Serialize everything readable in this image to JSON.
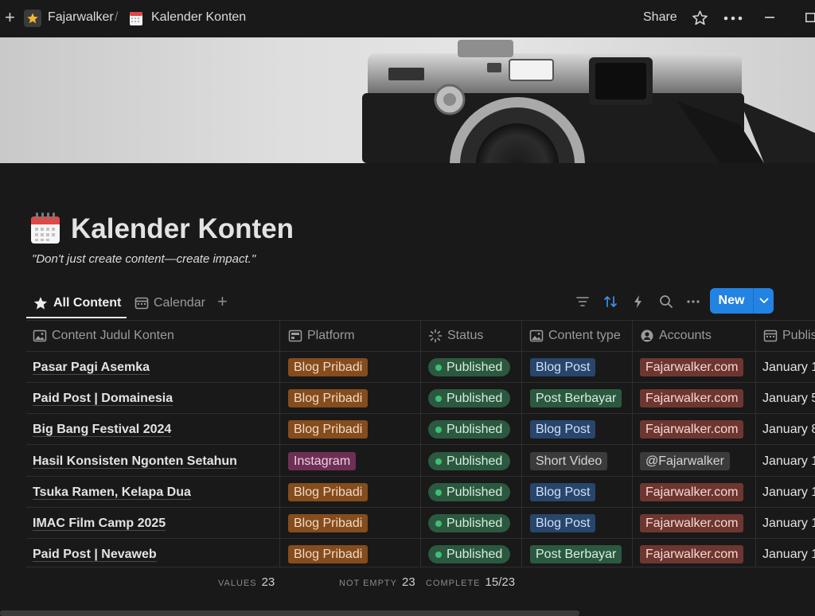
{
  "topbar": {
    "workspace": "Fajarwalker",
    "separator": "/",
    "page": "Kalender Konten",
    "share_label": "Share",
    "icons": [
      "plus-icon",
      "star-icon",
      "calendar-icon",
      "favorite-star-icon",
      "more-icon",
      "minimize-icon",
      "maximize-icon"
    ]
  },
  "page": {
    "title": "Kalender Konten",
    "quote": "\"Don't just create content—create impact.\""
  },
  "tabs": [
    {
      "label": "All Content",
      "active": true
    },
    {
      "label": "Calendar",
      "active": false
    }
  ],
  "toolbar": {
    "new_label": "New",
    "accent": "#2383e2"
  },
  "table": {
    "columns": [
      "Content Judul Konten",
      "Platform",
      "Status",
      "Content type",
      "Accounts",
      "Publis"
    ],
    "rows": [
      {
        "title": "Pasar Pagi Asemka",
        "platform": "Blog Pribadi",
        "status": "Published",
        "type": "Blog Post",
        "account": "Fajarwalker.com",
        "date": "January 1"
      },
      {
        "title": "Paid Post | Domainesia",
        "platform": "Blog Pribadi",
        "status": "Published",
        "type": "Post Berbayar",
        "account": "Fajarwalker.com",
        "date": "January 5"
      },
      {
        "title": "Big Bang Festival 2024",
        "platform": "Blog Pribadi",
        "status": "Published",
        "type": "Blog Post",
        "account": "Fajarwalker.com",
        "date": "January 8"
      },
      {
        "title": "Hasil Konsisten Ngonten Setahun",
        "platform": "Instagram",
        "status": "Published",
        "type": "Short Video",
        "account": "@Fajarwalker",
        "date": "January 1"
      },
      {
        "title": "Tsuka Ramen, Kelapa Dua",
        "platform": "Blog Pribadi",
        "status": "Published",
        "type": "Blog Post",
        "account": "Fajarwalker.com",
        "date": "January 1"
      },
      {
        "title": "IMAC Film Camp 2025",
        "platform": "Blog Pribadi",
        "status": "Published",
        "type": "Blog Post",
        "account": "Fajarwalker.com",
        "date": "January 1"
      },
      {
        "title": "Paid Post | Nevaweb",
        "platform": "Blog Pribadi",
        "status": "Published",
        "type": "Post Berbayar",
        "account": "Fajarwalker.com",
        "date": "January 1"
      }
    ]
  },
  "footer": {
    "values_label": "VALUES",
    "values": "23",
    "not_empty_label": "NOT EMPTY",
    "not_empty": "23",
    "complete_label": "COMPLETE",
    "complete": "15/23"
  }
}
